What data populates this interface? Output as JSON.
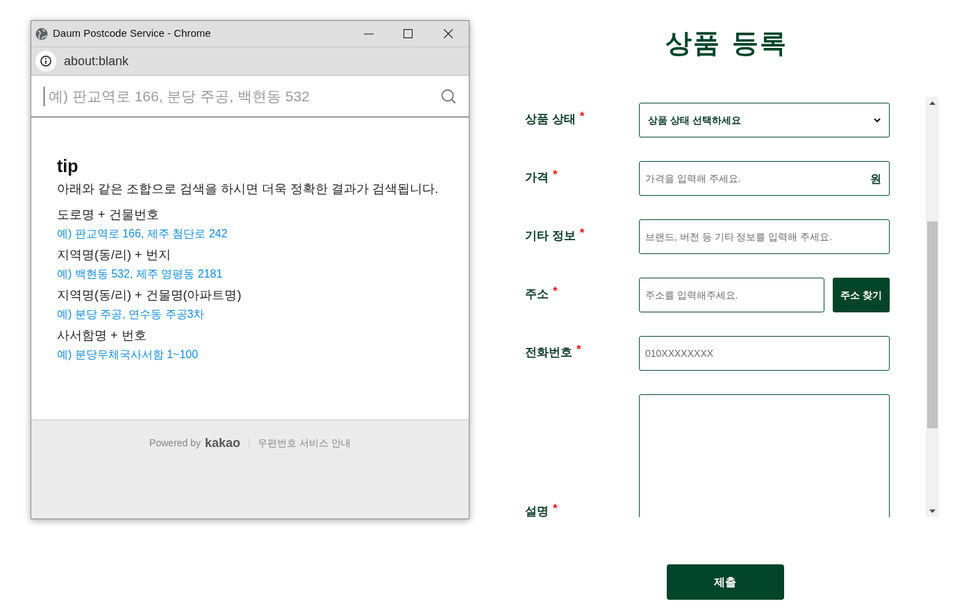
{
  "popup": {
    "title": "Daum Postcode Service - Chrome",
    "url": "about:blank",
    "search": {
      "placeholder": "예) 판교역로 166, 분당 주공, 백현동 532"
    },
    "tip": {
      "heading": "tip",
      "intro": "아래와 같은 조합으로 검색을 하시면 더욱 정확한 결과가 검색됩니다.",
      "items": [
        {
          "label": "도로명 + 건물번호",
          "example": "예) 판교역로 166,  제주 첨단로 242"
        },
        {
          "label": "지역명(동/리) + 번지",
          "example": "예) 백현동 532,  제주 영평동 2181"
        },
        {
          "label": "지역명(동/리) + 건물명(아파트명)",
          "example": "예) 분당 주공,  연수동 주공3차"
        },
        {
          "label": "사서함명 + 번호",
          "example": "예) 분당우체국사서함 1~100"
        }
      ]
    },
    "footer": {
      "powered_by": "Powered by",
      "brand": "kakao",
      "link": "우편번호 서비스 안내"
    }
  },
  "form": {
    "title": "상품 등록",
    "fields": [
      {
        "kind": "select",
        "label": "상품 상태",
        "required_mark": "*",
        "value": "상품 상태 선택하세요"
      },
      {
        "kind": "suffix",
        "label": "가격",
        "required_mark": "*",
        "placeholder": "가격을 입력해 주세요.",
        "suffix": "원"
      },
      {
        "kind": "input",
        "label": "기타 정보",
        "required_mark": "*",
        "placeholder": "브랜드, 버전 등 기타 정보를 입력해 주세요."
      },
      {
        "kind": "button",
        "label": "주소",
        "required_mark": "*",
        "placeholder": "주소를 입력해주세요.",
        "button": "주소 찾기"
      },
      {
        "kind": "input",
        "label": "전화번호",
        "required_mark": "*",
        "placeholder": "010XXXXXXXX"
      },
      {
        "kind": "textarea",
        "label": "설명",
        "required_mark": "*"
      }
    ],
    "submit": "제출"
  }
}
